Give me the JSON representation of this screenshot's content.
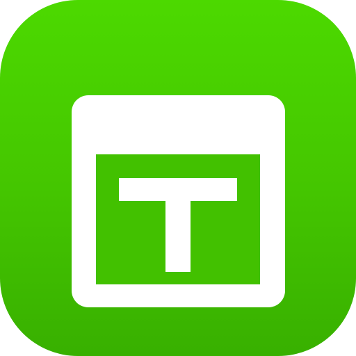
{
  "icon": {
    "name": "template-t-icon",
    "background_colors": [
      "#4cd900",
      "#45c700",
      "#38b000"
    ],
    "glyph_color": "#ffffff"
  }
}
